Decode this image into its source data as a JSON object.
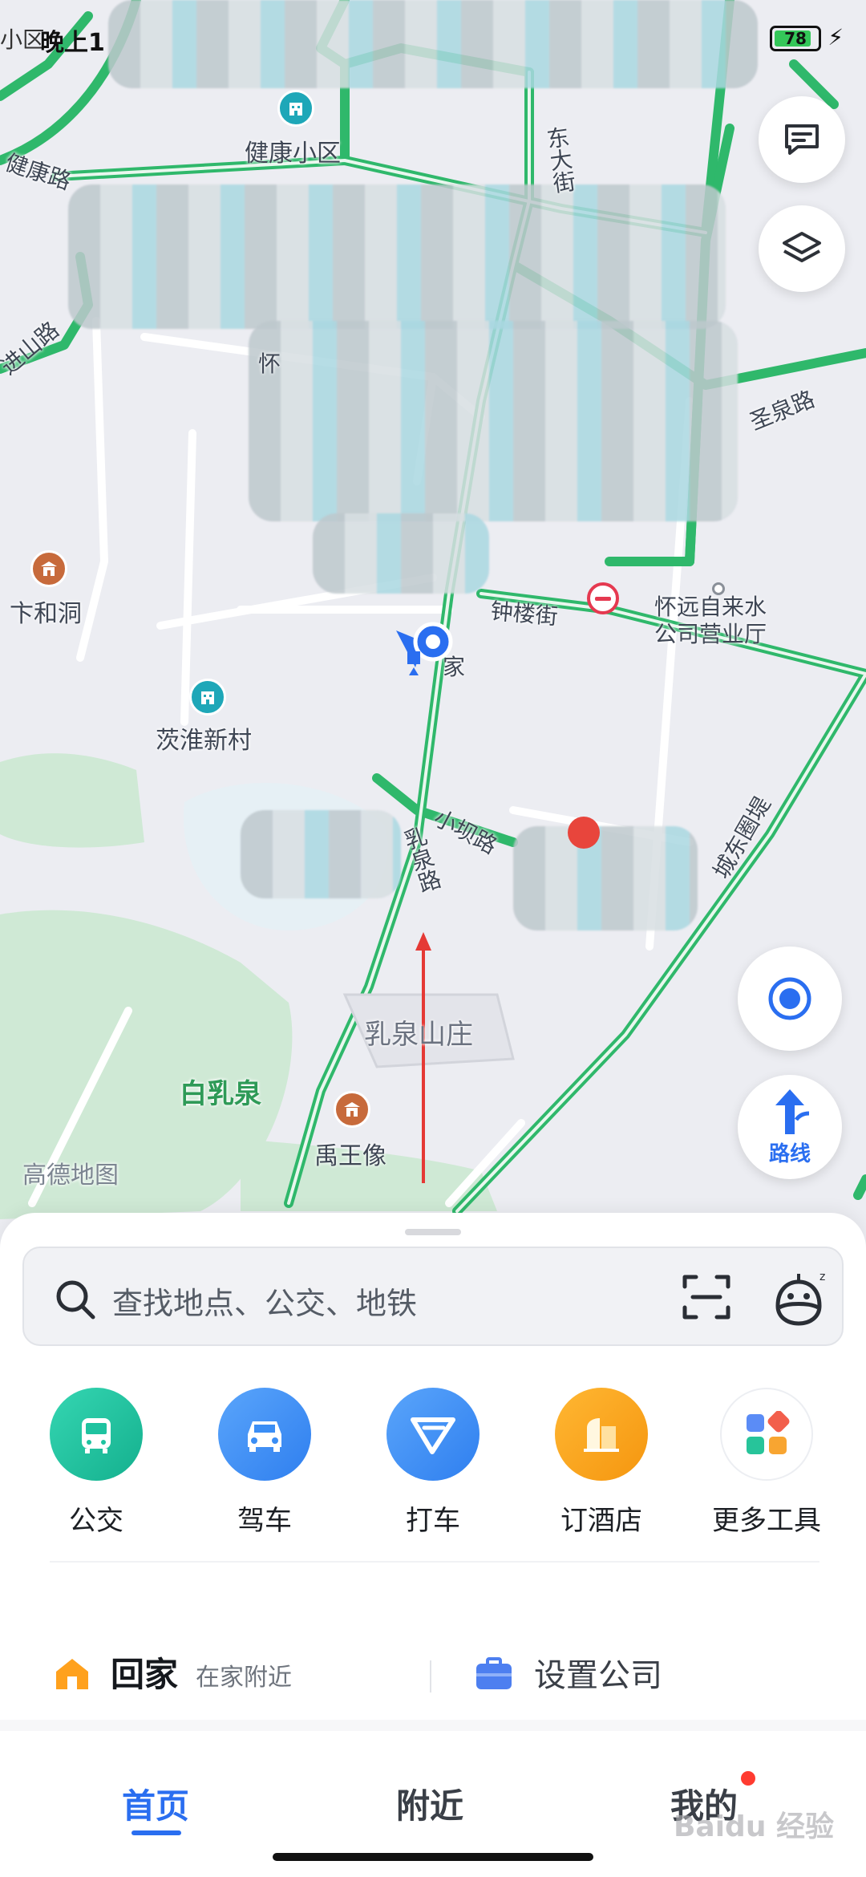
{
  "status_bar": {
    "left_cut_text": "小区",
    "time": "晚上1",
    "battery": "78",
    "battery_level_percent": 78
  },
  "map": {
    "labels": {
      "jiankang_xiaoqu": "健康小区",
      "jiankang_road": "健康路",
      "dong_da_jie": "东大街",
      "jinshan_road": "进山路",
      "huai_partial": "怀",
      "shengquan_road": "圣泉路",
      "bianhe_dong": "卞和洞",
      "zhonglou_jie": "钟楼街",
      "water_company": "怀远自来水\n公司营业厅",
      "home_marker_label": "家",
      "cihuai_xincun": "茨淮新村",
      "xiaoba_road": "小坝路",
      "chengdong_weiti": "城东圈堤",
      "ruquan_road": "乳泉路",
      "ruquan_shanzhuang": "乳泉山庄",
      "bai_ruquan": "白乳泉",
      "yuwang_xiang": "禹王像",
      "amap_brand": "高德地图"
    }
  },
  "controls": {
    "message_icon": "message-icon",
    "layers_icon": "layers-icon",
    "locate_icon": "locate-icon",
    "route_label": "路线"
  },
  "search": {
    "placeholder": "查找地点、公交、地铁"
  },
  "tools": [
    {
      "label": "公交",
      "color": "#1fc3a0",
      "icon": "bus-icon"
    },
    {
      "label": "驾车",
      "color": "#3b8ef5",
      "icon": "car-icon"
    },
    {
      "label": "打车",
      "color": "#3b8ef5",
      "icon": "taxi-icon"
    },
    {
      "label": "订酒店",
      "color": "#f7a21a",
      "icon": "hotel-icon"
    },
    {
      "label": "更多工具",
      "color": "#ffffff",
      "icon": "more-tools-icon"
    }
  ],
  "shortcuts": {
    "home_label": "回家",
    "home_sub": "在家附近",
    "company_label": "设置公司"
  },
  "tabs": {
    "home": "首页",
    "nearby": "附近",
    "mine": "我的"
  },
  "watermark": "Baidu 经验",
  "colors": {
    "accent": "#2a6ef0",
    "road": "#2fb86b",
    "badge": "#ff3b30"
  }
}
